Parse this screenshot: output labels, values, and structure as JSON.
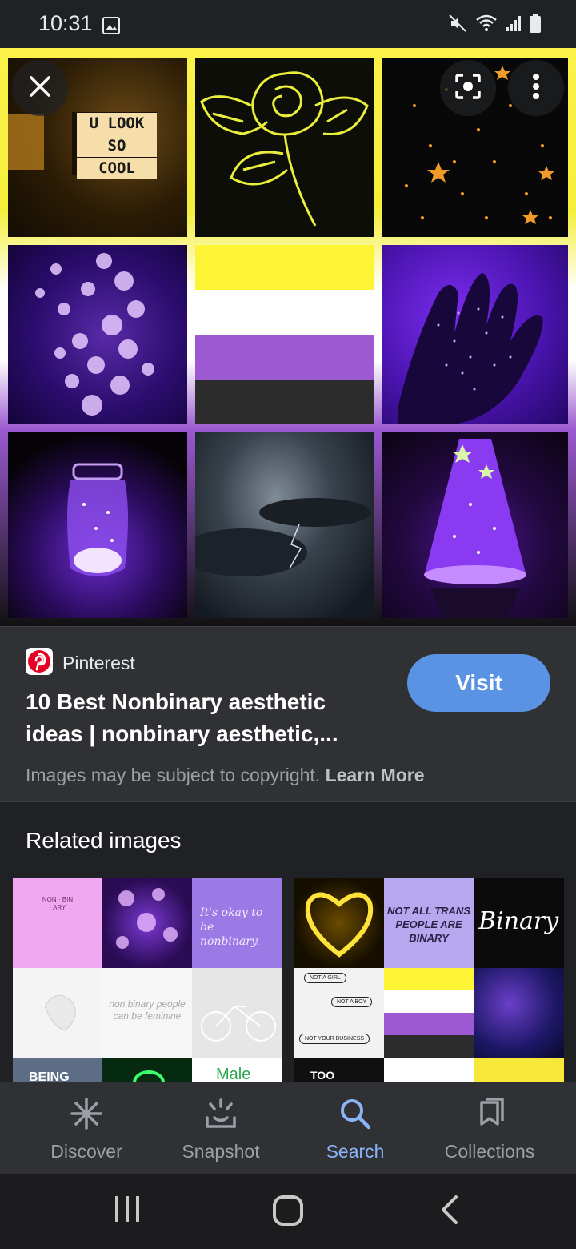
{
  "status_bar": {
    "time": "10:31",
    "icons": [
      "image-notification-icon",
      "mute-icon",
      "wifi-icon",
      "signal-icon",
      "battery-icon"
    ]
  },
  "viewer": {
    "close_icon": "close-icon",
    "lens_icon": "google-lens-icon",
    "more_icon": "more-vert-icon",
    "tile_text": {
      "lightbox_line1": "U LOOK",
      "lightbox_line2": "SO",
      "lightbox_line3": "COOL"
    }
  },
  "source": {
    "site_name": "Pinterest",
    "title": "10 Best Nonbinary aesthetic ideas | nonbinary aesthetic,...",
    "visit_label": "Visit",
    "copyright_text": "Images may be subject to copyright.",
    "learn_more": "Learn More"
  },
  "related": {
    "heading": "Related images",
    "left_text": {
      "non_bin_ary": "NON · BIN · ARY",
      "okay": "It's okay to be nonbinary.",
      "feminine": "non binary people can be feminine",
      "being": "BEING",
      "male": "Male"
    },
    "right_text": {
      "not_all_trans": "NOT ALL TRANS PEOPLE ARE BINARY",
      "binary_logo": "Binary",
      "not_a_girl": "NOT A GIRL",
      "not_a_boy": "NOT A BOY",
      "not_your_business": "NOT YOUR BUSINESS",
      "too": "TOO"
    }
  },
  "bottom_nav": {
    "items": [
      {
        "label": "Discover",
        "icon": "discover-asterisk-icon"
      },
      {
        "label": "Snapshot",
        "icon": "snapshot-icon"
      },
      {
        "label": "Search",
        "icon": "search-icon",
        "active": true
      },
      {
        "label": "Collections",
        "icon": "collections-bookmark-icon"
      }
    ]
  },
  "system_nav": {
    "icons": [
      "recents-icon",
      "home-icon",
      "back-icon"
    ]
  },
  "colors": {
    "accent": "#8ab4f8",
    "visit_button": "#5b93e4",
    "background": "#202124",
    "panel": "#303134",
    "nb_yellow": "#fcf434",
    "nb_purple": "#9c59d1",
    "nb_black": "#2c2c2c"
  }
}
